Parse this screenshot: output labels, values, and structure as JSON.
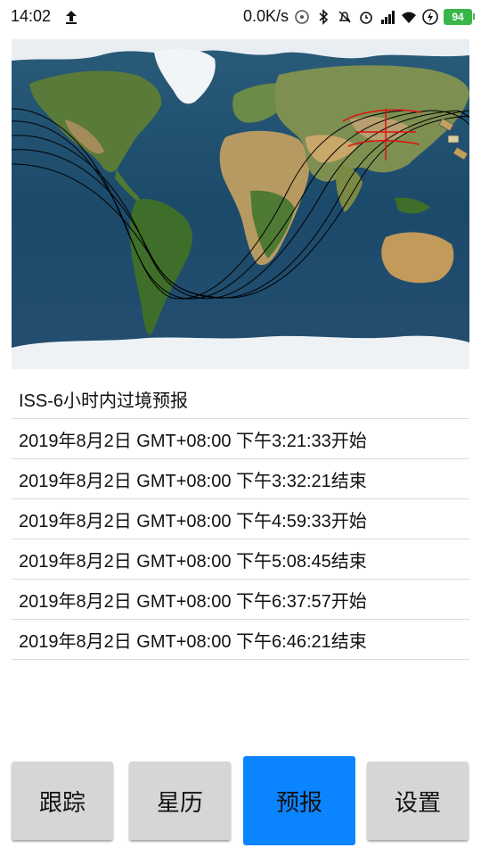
{
  "status_bar": {
    "time": "14:02",
    "network_speed": "0.0K/s",
    "battery": "94",
    "icons": [
      "upload-arrow-icon",
      "hotspot-icon",
      "bluetooth-icon",
      "mute-icon",
      "alarm-icon",
      "hd-signal-icon",
      "wifi-icon",
      "charging-icon"
    ]
  },
  "map": {
    "satellite_icon": "satellite-icon",
    "track_color": "#000000",
    "observer_marker_color": "#e01010"
  },
  "list": {
    "header": "ISS-6小时内过境预报",
    "items": [
      "2019年8月2日 GMT+08:00 下午3:21:33开始",
      "2019年8月2日 GMT+08:00 下午3:32:21结束",
      "2019年8月2日 GMT+08:00 下午4:59:33开始",
      "2019年8月2日 GMT+08:00 下午5:08:45结束",
      "2019年8月2日 GMT+08:00 下午6:37:57开始",
      "2019年8月2日 GMT+08:00 下午6:46:21结束"
    ]
  },
  "buttons": {
    "track": "跟踪",
    "ephemeris": "星历",
    "forecast": "预报",
    "settings": "设置",
    "active": "forecast",
    "active_color": "#0b84ff"
  }
}
